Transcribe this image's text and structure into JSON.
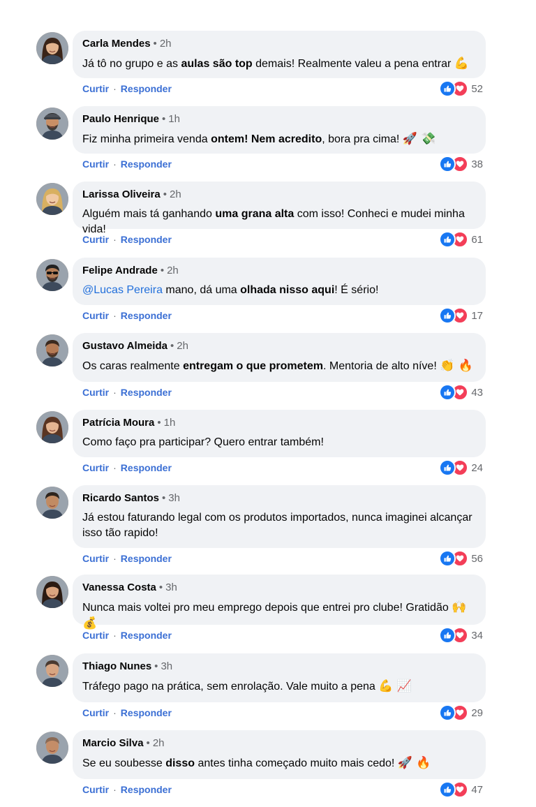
{
  "actions": {
    "like_label": "Curtir",
    "reply_label": "Responder",
    "separator": "·"
  },
  "meta_separator": "•",
  "comments": [
    {
      "name": "Carla Mendes",
      "time": "2h",
      "segments": [
        {
          "t": "Já tô no grupo e as "
        },
        {
          "t": "aulas são top",
          "b": true
        },
        {
          "t": " demais! Realmente valeu a pena entrar "
        },
        {
          "t": "💪",
          "e": true
        }
      ],
      "reactions": "52",
      "avatar": "woman-dark-hair"
    },
    {
      "name": "Paulo Henrique",
      "time": "1h",
      "segments": [
        {
          "t": "Fiz minha primeira venda "
        },
        {
          "t": "ontem! Nem acredito",
          "b": true
        },
        {
          "t": ", bora pra cima! "
        },
        {
          "t": "🚀 💸",
          "e": true
        }
      ],
      "reactions": "38",
      "avatar": "man-cap"
    },
    {
      "name": "Larissa Oliveira",
      "time": "2h",
      "segments": [
        {
          "t": "Alguém mais tá ganhando "
        },
        {
          "t": "uma grana alta",
          "b": true
        },
        {
          "t": " com isso! Conheci e mudei minha vida!"
        }
      ],
      "reactions": "61",
      "avatar": "woman-blonde"
    },
    {
      "name": "Felipe Andrade",
      "time": "2h",
      "segments": [
        {
          "t": "@Lucas Pereira",
          "m": true
        },
        {
          "t": " mano, dá uma "
        },
        {
          "t": "olhada nisso aqui",
          "b": true
        },
        {
          "t": "! É sério!"
        }
      ],
      "reactions": "17",
      "avatar": "man-sunglasses"
    },
    {
      "name": "Gustavo Almeida",
      "time": "2h",
      "segments": [
        {
          "t": "Os caras realmente "
        },
        {
          "t": "entregam o que prometem",
          "b": true
        },
        {
          "t": ". Mentoria de alto níve! "
        },
        {
          "t": "👏 🔥",
          "e": true
        }
      ],
      "reactions": "43",
      "avatar": "man-beard"
    },
    {
      "name": "Patrícia Moura",
      "time": "1h",
      "segments": [
        {
          "t": "Como faço pra participar? Quero entrar também!"
        }
      ],
      "reactions": "24",
      "avatar": "woman-brown-hair"
    },
    {
      "name": "Ricardo Santos",
      "time": "3h",
      "segments": [
        {
          "t": "Já estou faturando legal com os produtos importados, nunca imaginei alcançar isso tão rapido!"
        }
      ],
      "reactions": "56",
      "avatar": "man-smile"
    },
    {
      "name": "Vanessa Costa",
      "time": "3h",
      "segments": [
        {
          "t": "Nunca mais voltei pro meu emprego depois que entrei pro clube! Gratidão "
        },
        {
          "t": "🙌 💰",
          "e": true
        }
      ],
      "reactions": "34",
      "avatar": "woman-long-hair"
    },
    {
      "name": "Thiago Nunes",
      "time": "3h",
      "segments": [
        {
          "t": "Tráfego pago na prática, sem enrolação. Vale muito a pena "
        },
        {
          "t": "💪 📈",
          "e": true
        }
      ],
      "reactions": "29",
      "avatar": "man-short-hair"
    },
    {
      "name": "Marcio Silva",
      "time": "2h",
      "segments": [
        {
          "t": "Se eu soubesse "
        },
        {
          "t": "disso",
          "b": true
        },
        {
          "t": " antes tinha começado muito mais cedo! "
        },
        {
          "t": "🚀 🔥",
          "e": true
        }
      ],
      "reactions": "47",
      "avatar": "man-bald"
    }
  ],
  "colors": {
    "bubble": "#f0f2f5",
    "action_link": "#3b6fd4",
    "mention": "#216fdb",
    "like": "#1877f2",
    "love": "#f33e58",
    "meta_gray": "#65676b"
  }
}
